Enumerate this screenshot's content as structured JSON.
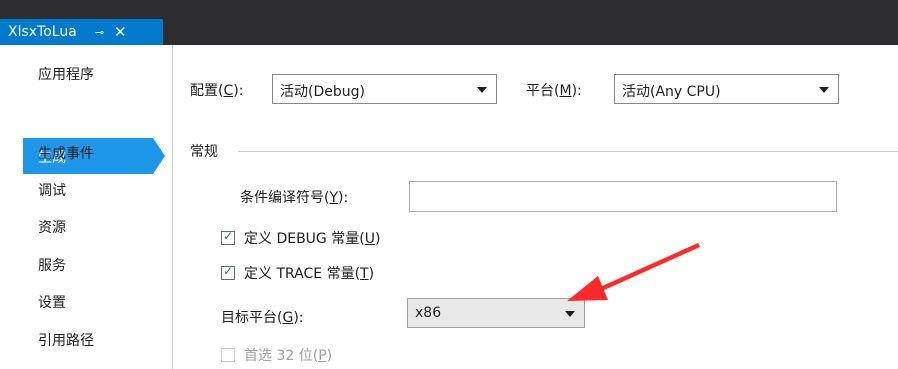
{
  "tab": {
    "title": "XlsxToLua",
    "pin": "⊸",
    "close": "✕"
  },
  "sidebar": {
    "items": [
      "应用程序",
      "生成",
      "生成事件",
      "调试",
      "资源",
      "服务",
      "设置",
      "引用路径"
    ],
    "selected": "生成"
  },
  "config": {
    "label": "配置",
    "key": "C",
    "value": "活动(Debug)"
  },
  "platform": {
    "label": "平台",
    "key": "M",
    "value": "活动(Any CPU)"
  },
  "general": {
    "section_label": "常规"
  },
  "conditional_symbols": {
    "label": "条件编译符号",
    "key": "Y",
    "value": ""
  },
  "define_debug": {
    "label": "定义 DEBUG 常量",
    "key": "U",
    "checked": true
  },
  "define_trace": {
    "label": "定义 TRACE 常量",
    "key": "T",
    "checked": true
  },
  "target_platform": {
    "label": "目标平台",
    "key": "G",
    "value": "x86"
  },
  "prefer32": {
    "label": "首选 32 位",
    "key": "P",
    "checked": false,
    "disabled": true
  },
  "colors": {
    "accent": "#007acc",
    "selected": "#1c97ea",
    "annotation": "#ff2a2a",
    "titlebar": "#2d2d30"
  }
}
